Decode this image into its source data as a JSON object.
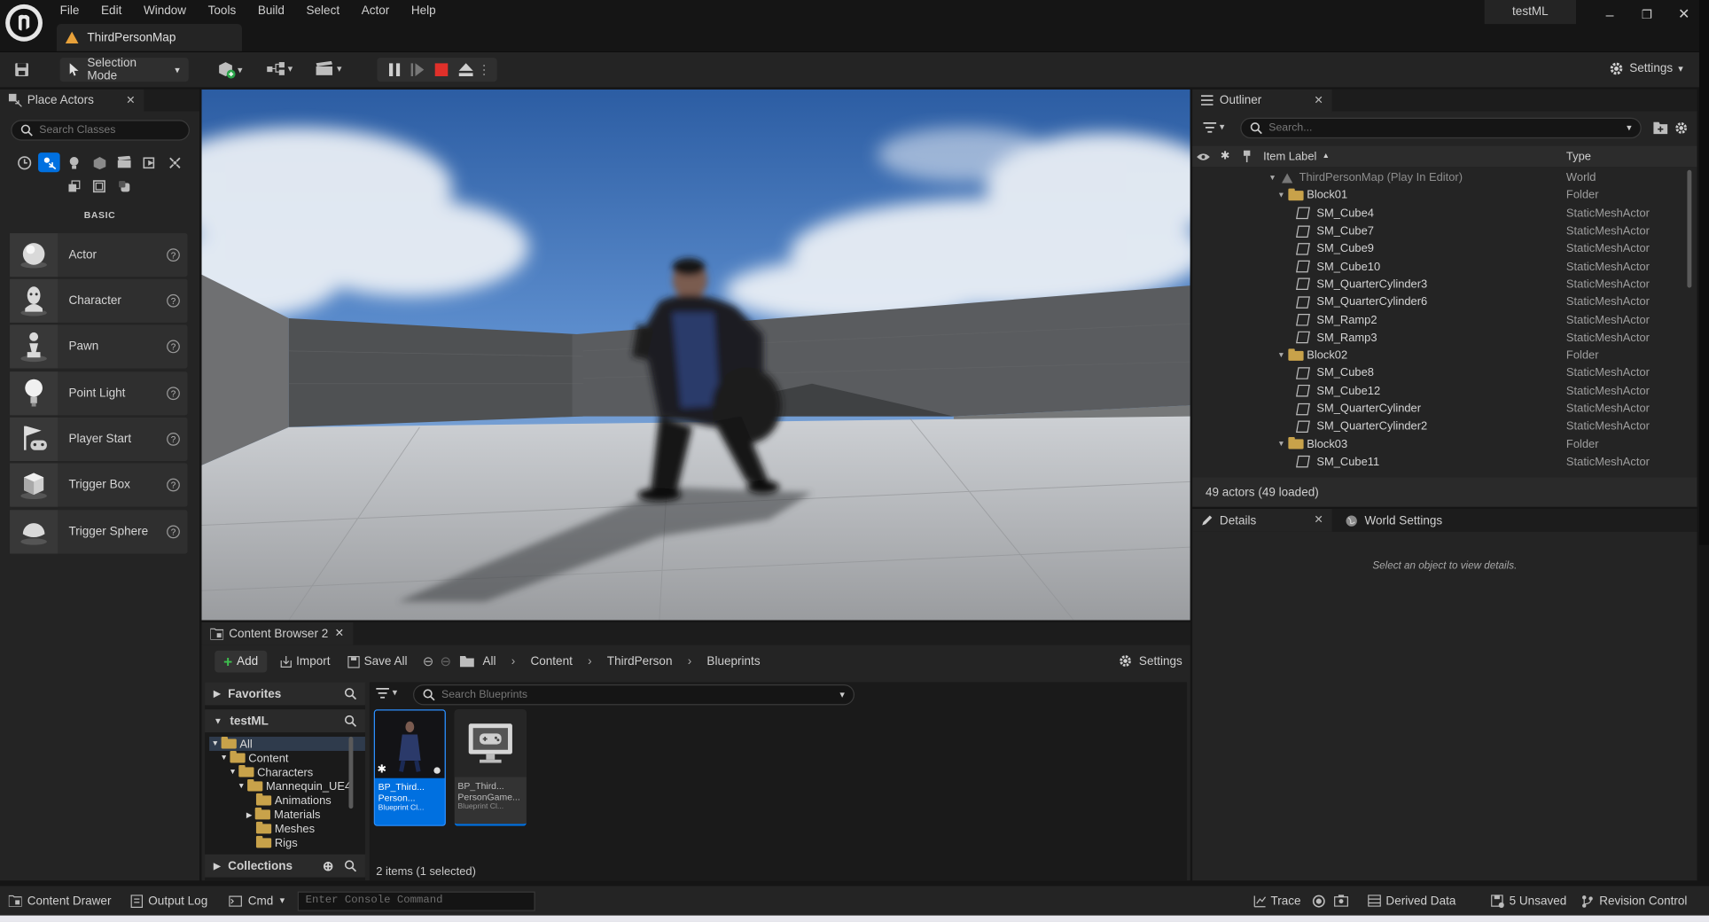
{
  "menu": [
    "File",
    "Edit",
    "Window",
    "Tools",
    "Build",
    "Select",
    "Actor",
    "Help"
  ],
  "project_name": "testML",
  "map_tab": "ThirdPersonMap",
  "window_buttons": {
    "minimize": "–",
    "restore": "❐",
    "close": "✕"
  },
  "toolbar": {
    "selection_mode": "Selection Mode",
    "settings": "Settings"
  },
  "place_actors": {
    "tab_label": "Place Actors",
    "search_placeholder": "Search Classes",
    "section": "BASIC",
    "items": [
      {
        "label": "Actor",
        "icon": "sphere-icon"
      },
      {
        "label": "Character",
        "icon": "character-icon"
      },
      {
        "label": "Pawn",
        "icon": "pawn-icon"
      },
      {
        "label": "Point Light",
        "icon": "point-light-icon"
      },
      {
        "label": "Player Start",
        "icon": "player-start-icon"
      },
      {
        "label": "Trigger Box",
        "icon": "trigger-box-icon"
      },
      {
        "label": "Trigger Sphere",
        "icon": "trigger-sphere-icon"
      }
    ]
  },
  "content_browser": {
    "tab_label": "Content Browser 2",
    "add": "Add",
    "import": "Import",
    "save_all": "Save All",
    "breadcrumb": [
      "All",
      "Content",
      "ThirdPerson",
      "Blueprints"
    ],
    "settings": "Settings",
    "favorites": "Favorites",
    "project_root": "testML",
    "tree": [
      {
        "label": "All",
        "depth": 0,
        "expanded": true
      },
      {
        "label": "Content",
        "depth": 1,
        "expanded": true
      },
      {
        "label": "Characters",
        "depth": 2,
        "expanded": true
      },
      {
        "label": "Mannequin_UE4",
        "depth": 3,
        "expanded": true
      },
      {
        "label": "Animations",
        "depth": 4,
        "expanded": false
      },
      {
        "label": "Materials",
        "depth": 4,
        "expanded": false,
        "has_children": true
      },
      {
        "label": "Meshes",
        "depth": 4,
        "expanded": false
      },
      {
        "label": "Rigs",
        "depth": 4,
        "expanded": false
      }
    ],
    "collections": "Collections",
    "search_placeholder": "Search Blueprints",
    "assets": [
      {
        "name_line1": "BP_Third...",
        "name_line2": "Person...",
        "type": "Blueprint Cl...",
        "selected": true
      },
      {
        "name_line1": "BP_Third...",
        "name_line2": "PersonGame...",
        "type": "Blueprint Cl...",
        "selected": false
      }
    ],
    "status": "2 items (1 selected)"
  },
  "outliner": {
    "tab_label": "Outliner",
    "search_placeholder": "Search...",
    "col_label": "Item Label",
    "col_type": "Type",
    "rows": [
      {
        "label": "ThirdPersonMap (Play In Editor)",
        "type": "World",
        "kind": "world",
        "depth": 0
      },
      {
        "label": "Block01",
        "type": "Folder",
        "kind": "folder",
        "depth": 1
      },
      {
        "label": "SM_Cube4",
        "type": "StaticMeshActor",
        "kind": "mesh",
        "depth": 2
      },
      {
        "label": "SM_Cube7",
        "type": "StaticMeshActor",
        "kind": "mesh",
        "depth": 2
      },
      {
        "label": "SM_Cube9",
        "type": "StaticMeshActor",
        "kind": "mesh",
        "depth": 2
      },
      {
        "label": "SM_Cube10",
        "type": "StaticMeshActor",
        "kind": "mesh",
        "depth": 2
      },
      {
        "label": "SM_QuarterCylinder3",
        "type": "StaticMeshActor",
        "kind": "mesh",
        "depth": 2
      },
      {
        "label": "SM_QuarterCylinder6",
        "type": "StaticMeshActor",
        "kind": "mesh",
        "depth": 2
      },
      {
        "label": "SM_Ramp2",
        "type": "StaticMeshActor",
        "kind": "mesh",
        "depth": 2
      },
      {
        "label": "SM_Ramp3",
        "type": "StaticMeshActor",
        "kind": "mesh",
        "depth": 2
      },
      {
        "label": "Block02",
        "type": "Folder",
        "kind": "folder",
        "depth": 1
      },
      {
        "label": "SM_Cube8",
        "type": "StaticMeshActor",
        "kind": "mesh",
        "depth": 2
      },
      {
        "label": "SM_Cube12",
        "type": "StaticMeshActor",
        "kind": "mesh",
        "depth": 2
      },
      {
        "label": "SM_QuarterCylinder",
        "type": "StaticMeshActor",
        "kind": "mesh",
        "depth": 2
      },
      {
        "label": "SM_QuarterCylinder2",
        "type": "StaticMeshActor",
        "kind": "mesh",
        "depth": 2
      },
      {
        "label": "Block03",
        "type": "Folder",
        "kind": "folder",
        "depth": 1
      },
      {
        "label": "SM_Cube11",
        "type": "StaticMeshActor",
        "kind": "mesh",
        "depth": 2
      }
    ],
    "count": "49 actors (49 loaded)"
  },
  "details": {
    "tab_label": "Details",
    "world_settings": "World Settings",
    "empty_text": "Select an object to view details."
  },
  "statusbar": {
    "content_drawer": "Content Drawer",
    "output_log": "Output Log",
    "cmd": "Cmd",
    "console_placeholder": "Enter Console Command",
    "trace": "Trace",
    "derived_data": "Derived Data",
    "unsaved": "5 Unsaved",
    "revision_control": "Revision Control"
  },
  "colors": {
    "accent": "#0070e0",
    "stop": "#e0302a",
    "folder": "#c8a24a"
  }
}
